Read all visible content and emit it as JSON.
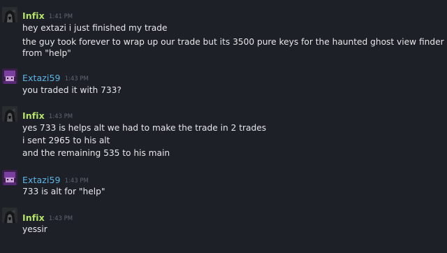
{
  "colors": {
    "background": "#1d2027",
    "infix_name": "#b5e36a",
    "extazi_name": "#5cb6e8",
    "timestamp": "#5f6672",
    "text": "#e6e8eb"
  },
  "messages": [
    {
      "author": "Infix",
      "avatar_icon": "hooded-figure-avatar",
      "time": "1:41 PM",
      "lines": [
        "hey extazi i just finished my trade",
        "the guy took forever to wrap up our trade but its 3500 pure keys for the haunted ghost view finder",
        "from \"help\""
      ]
    },
    {
      "author": "Extazi59",
      "avatar_icon": "purple-character-avatar",
      "time": "1:43 PM",
      "lines": [
        "you traded it with 733?"
      ]
    },
    {
      "author": "Infix",
      "avatar_icon": "hooded-figure-avatar",
      "time": "1:43 PM",
      "lines": [
        "yes 733 is helps alt we had to make the trade in 2 trades",
        "i sent 2965 to his alt",
        "and the remaining 535 to his main"
      ]
    },
    {
      "author": "Extazi59",
      "avatar_icon": "purple-character-avatar",
      "time": "1:43 PM",
      "lines": [
        "733 is alt for \"help\""
      ]
    },
    {
      "author": "Infix",
      "avatar_icon": "hooded-figure-avatar",
      "time": "1:43 PM",
      "lines": [
        "yessir"
      ]
    }
  ]
}
